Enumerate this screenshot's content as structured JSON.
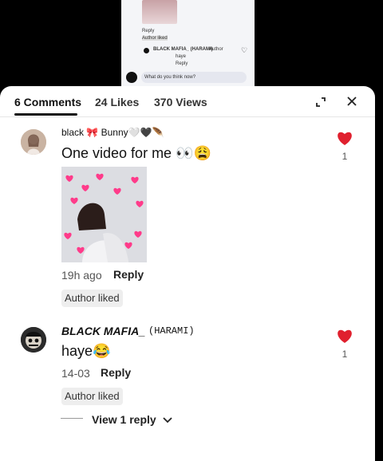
{
  "video": {
    "reply_1": "Reply",
    "author_liked": "Author liked",
    "commenter": "BLACK MAFIA_ (HARAMI)",
    "author_badge": "Author",
    "reply_text": "haye",
    "reply_2": "Reply",
    "input_placeholder": "What do you think now?"
  },
  "header": {
    "comments": "6 Comments",
    "likes": "24 Likes",
    "views": "370 Views"
  },
  "comments": [
    {
      "author": "black 🎀 Bunny🤍🖤🪶",
      "text": "One video for me 👀😩",
      "likes": "1",
      "time": "19h ago",
      "reply": "Reply",
      "author_liked": "Author liked"
    },
    {
      "author": "BLACK MAFIA_",
      "author_tag": "(HARAMI)",
      "text": "haye😂",
      "likes": "1",
      "time": "14-03",
      "reply": "Reply",
      "author_liked": "Author liked",
      "view_replies": "View 1 reply"
    }
  ],
  "colors": {
    "heart": "#e0202e",
    "sheet": "#ffffff"
  }
}
